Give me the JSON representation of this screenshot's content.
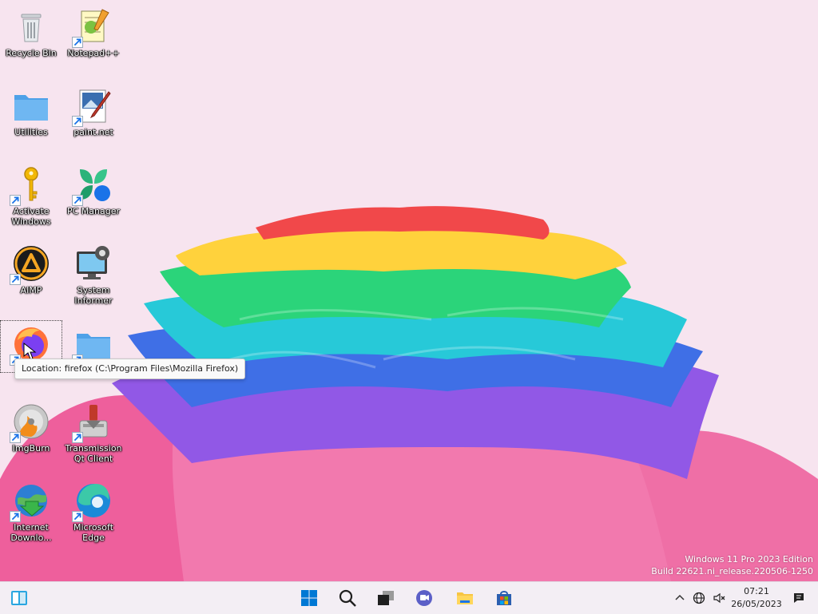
{
  "desktop": {
    "icons": [
      {
        "label": "Recycle Bin"
      },
      {
        "label": "Notepad++"
      },
      {
        "label": "Utilities"
      },
      {
        "label": "paint.net"
      },
      {
        "label": "Activate Windows"
      },
      {
        "label": "PC Manager"
      },
      {
        "label": "AIMP"
      },
      {
        "label": "System Informer"
      },
      {
        "label": ""
      },
      {
        "label": ""
      },
      {
        "label": "ImgBurn"
      },
      {
        "label": "Transmission Qt Client"
      },
      {
        "label": "Internet Downlo..."
      },
      {
        "label": "Microsoft Edge"
      }
    ],
    "tooltip": "Location: firefox (C:\\Program Files\\Mozilla Firefox)",
    "watermark": {
      "line1": "Windows 11 Pro 2023 Edition",
      "line2": "Build 22621.ni_release.220506-1250"
    }
  },
  "taskbar": {
    "items": [
      "Widgets",
      "Start",
      "Search",
      "Task View",
      "Chat",
      "File Explorer",
      "Microsoft Store"
    ],
    "tray": [
      "Show hidden icons",
      "Network",
      "Volume muted",
      "Notifications"
    ],
    "clock": {
      "time": "07:21",
      "date": "26/05/2023"
    }
  },
  "colors": {
    "accent": "#0078d4",
    "background": "#f7e3ee"
  }
}
